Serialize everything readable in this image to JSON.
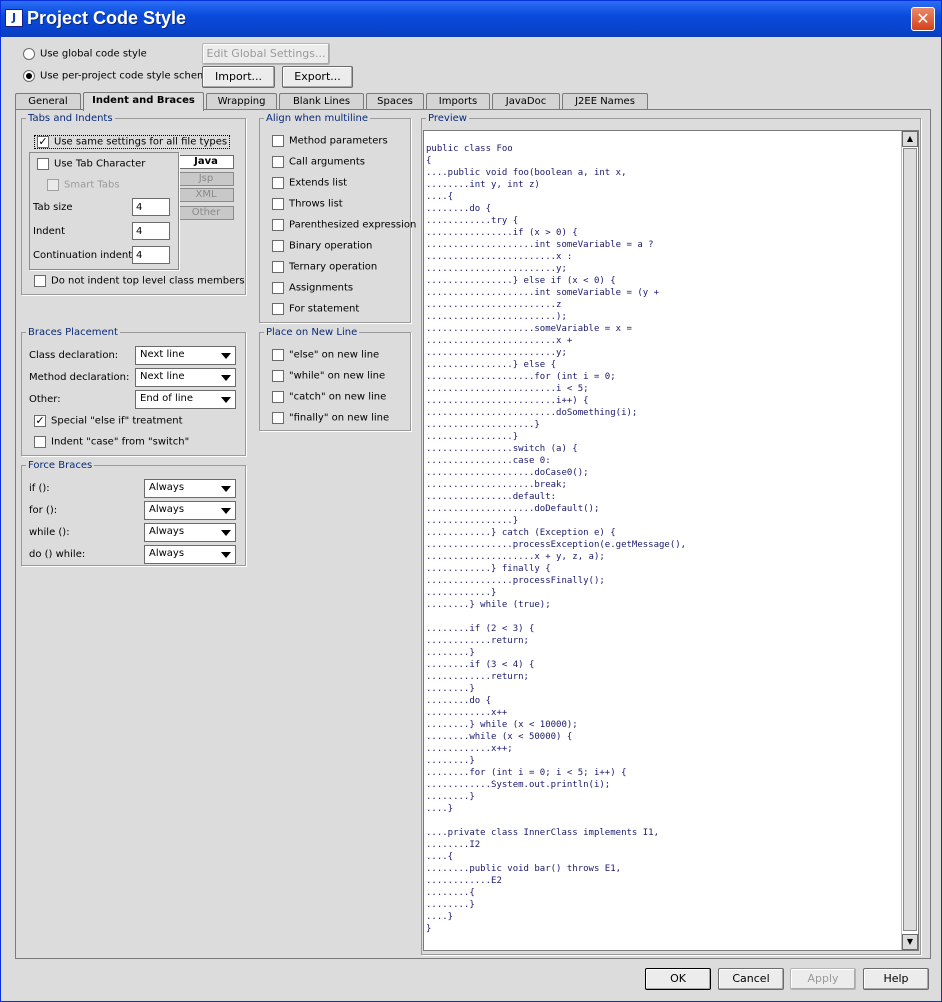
{
  "window": {
    "title": "Project Code Style",
    "close": "✕",
    "icon": "ij-app-icon"
  },
  "scope": {
    "global_label": "Use global code style",
    "per_project_label": "Use per-project code style scheme",
    "selected": "per_project",
    "edit_global": "Edit Global Settings...",
    "import": "Import...",
    "export": "Export..."
  },
  "tabs": [
    "General",
    "Indent and Braces",
    "Wrapping",
    "Blank Lines",
    "Spaces",
    "Imports",
    "JavaDoc",
    "J2EE Names"
  ],
  "active_tab": "Indent and Braces",
  "tabs_indents": {
    "title": "Tabs and Indents",
    "same_settings": "Use same settings for all file types",
    "file_types": [
      "Java",
      "Jsp",
      "XML",
      "Other"
    ],
    "use_tab_char": "Use Tab Character",
    "smart_tabs": "Smart Tabs",
    "tab_size_label": "Tab size",
    "tab_size": "4",
    "indent_label": "Indent",
    "indent": "4",
    "continuation_label": "Continuation indent",
    "continuation": "4",
    "no_indent_top": "Do not indent top level class members"
  },
  "align": {
    "title": "Align when multiline",
    "items": [
      "Method parameters",
      "Call arguments",
      "Extends list",
      "Throws list",
      "Parenthesized expression",
      "Binary operation",
      "Ternary operation",
      "Assignments",
      "For statement"
    ]
  },
  "braces": {
    "title": "Braces Placement",
    "class_label": "Class declaration:",
    "class_value": "Next line",
    "method_label": "Method declaration:",
    "method_value": "Next line",
    "other_label": "Other:",
    "other_value": "End of line",
    "special_else": "Special \"else if\" treatment",
    "indent_case": "Indent \"case\" from \"switch\""
  },
  "newline": {
    "title": "Place on New Line",
    "items": [
      "\"else\" on new line",
      "\"while\" on new line",
      "\"catch\" on new line",
      "\"finally\" on new line"
    ]
  },
  "force": {
    "title": "Force Braces",
    "if_label": "if ():",
    "if_value": "Always",
    "for_label": "for ():",
    "for_value": "Always",
    "while_label": "while ():",
    "while_value": "Always",
    "dowhile_label": "do () while:",
    "dowhile_value": "Always"
  },
  "preview": {
    "title": "Preview",
    "code": "public class Foo\n{\n....public void foo(boolean a, int x,\n........int y, int z)\n....{\n........do {\n............try {\n................if (x > 0) {\n....................int someVariable = a ?\n........................x :\n........................y;\n................} else if (x < 0) {\n....................int someVariable = (y +\n........................z\n........................);\n....................someVariable = x =\n........................x +\n........................y;\n................} else {\n....................for (int i = 0;\n........................i < 5;\n........................i++) {\n........................doSomething(i);\n....................}\n................}\n................switch (a) {\n................case 0:\n....................doCase0();\n....................break;\n................default:\n....................doDefault();\n................}\n............} catch (Exception e) {\n................processException(e.getMessage(),\n....................x + y, z, a);\n............} finally {\n................processFinally();\n............}\n........} while (true);\n\n........if (2 < 3) {\n............return;\n........}\n........if (3 < 4) {\n............return;\n........}\n........do {\n............x++\n........} while (x < 10000);\n........while (x < 50000) {\n............x++;\n........}\n........for (int i = 0; i < 5; i++) {\n............System.out.println(i);\n........}\n....}\n\n....private class InnerClass implements I1,\n........I2\n....{\n........public void bar() throws E1,\n............E2\n........{\n........}\n....}\n}"
  },
  "footer": {
    "ok": "OK",
    "cancel": "Cancel",
    "apply": "Apply",
    "help": "Help"
  }
}
